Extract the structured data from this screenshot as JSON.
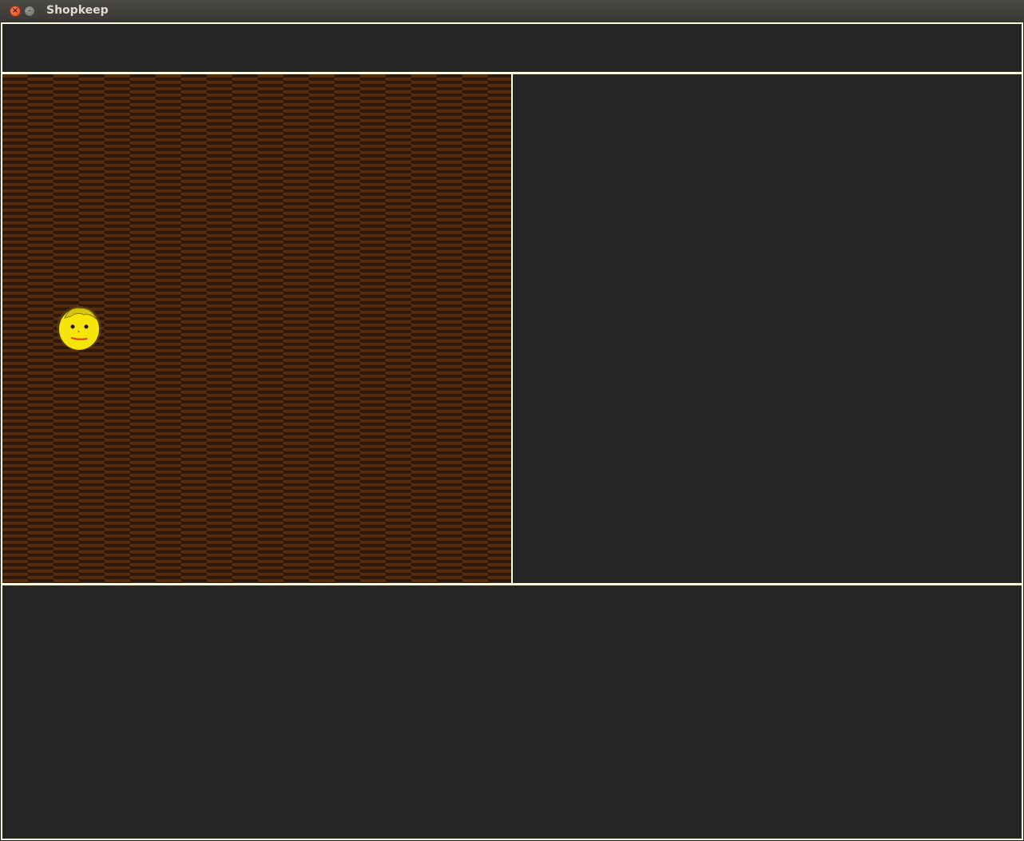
{
  "window": {
    "title": "Shopkeep",
    "close_icon": "close-icon",
    "minimize_icon": "minimize-icon"
  },
  "colors": {
    "background": "#262626",
    "panel_border": "#fffde0",
    "floor_light": "#552b09",
    "floor_dark": "#2e180c",
    "player_face": "#f6e40a"
  },
  "map": {
    "floor": "wood-plank-floor",
    "player": "smiley-face-character"
  }
}
